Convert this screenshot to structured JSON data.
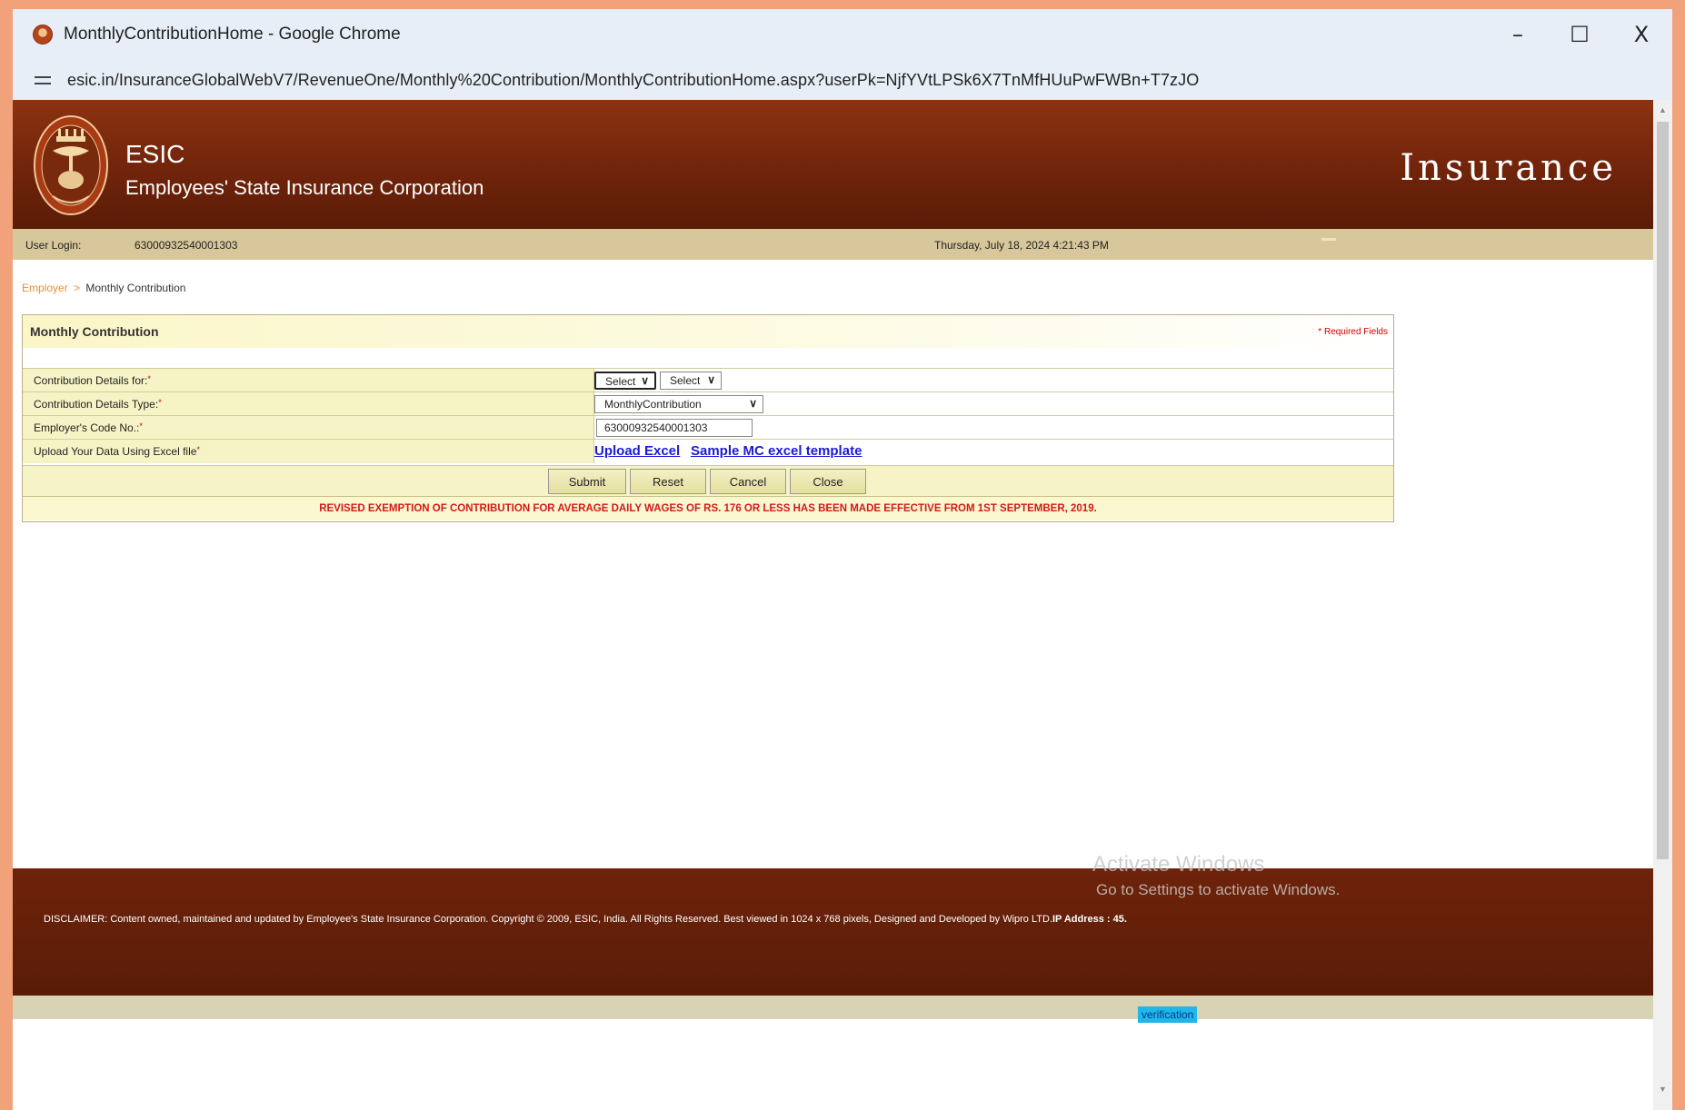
{
  "browser": {
    "window_title": "MonthlyContributionHome - Google Chrome",
    "url": "esic.in/InsuranceGlobalWebV7/RevenueOne/Monthly%20Contribution/MonthlyContributionHome.aspx?userPk=NjfYVtLPSk6X7TnMfHUuPwFWBn+T7zJO",
    "controls": {
      "minimize": "–",
      "maximize": "☐",
      "close": "X"
    }
  },
  "header": {
    "brand": "ESIC",
    "org_name": "Employees' State Insurance Corporation",
    "section": "Insurance"
  },
  "infobar": {
    "user_login_label": "User Login:",
    "user_login_value": "63000932540001303",
    "datetime": "Thursday, July 18, 2024 4:21:43 PM"
  },
  "breadcrumb": {
    "parent": "Employer",
    "separator": ">",
    "current": "Monthly Contribution"
  },
  "panel": {
    "title": "Monthly Contribution",
    "required_note": "* Required Fields"
  },
  "form": {
    "contribution_for": {
      "label": "Contribution Details for:",
      "select1": "Select",
      "select2": "Select"
    },
    "contribution_type": {
      "label": "Contribution Details Type:",
      "value": "MonthlyContribution"
    },
    "employer_code": {
      "label": "Employer's Code No.:",
      "value": "63000932540001303"
    },
    "upload": {
      "label": "Upload Your Data Using Excel file",
      "upload_link": "Upload Excel",
      "sample_link": "Sample MC excel template"
    },
    "required_marker": "*"
  },
  "buttons": {
    "submit": "Submit",
    "reset": "Reset",
    "cancel": "Cancel",
    "close": "Close"
  },
  "notice": "REVISED EXEMPTION OF CONTRIBUTION FOR AVERAGE DAILY WAGES OF RS. 176 OR LESS HAS BEEN MADE EFFECTIVE FROM 1ST SEPTEMBER, 2019.",
  "footer": {
    "disclaimer": "DISCLAIMER: Content owned, maintained and updated by Employee's State Insurance Corporation. Copyright © 2009, ESIC, India. All Rights Reserved. Best viewed in 1024 x 768 pixels, Designed and Developed by Wipro LTD.",
    "ip_label": "IP Address : 45."
  },
  "watermark": {
    "line1": "Activate Windows",
    "line2": "Go to Settings to activate Windows."
  },
  "status": {
    "verify": "verification"
  },
  "colors": {
    "header_brown": "#6e230a",
    "infobar_tan": "#d8c79b",
    "form_row_yellow": "#f6f4c6",
    "notice_red": "#d11a1a",
    "link_blue": "#1a1ad6",
    "breadcrumb_orange": "#e8902e"
  }
}
